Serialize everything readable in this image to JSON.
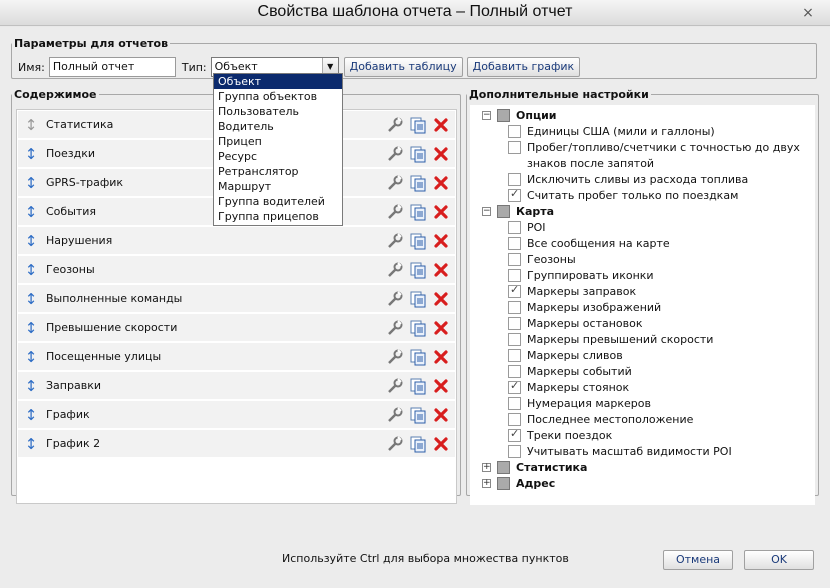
{
  "window": {
    "title": "Свойства шаблона отчета – Полный отчет",
    "close_glyph": "×"
  },
  "params": {
    "legend": "Параметры для отчетов",
    "name_label": "Имя:",
    "name_value": "Полный отчет",
    "type_label": "Тип:",
    "type_value": "Объект",
    "add_table": "Добавить таблицу",
    "add_chart": "Добавить график"
  },
  "type_dropdown": {
    "options": [
      "Объект",
      "Группа объектов",
      "Пользователь",
      "Водитель",
      "Прицеп",
      "Ресурс",
      "Ретранслятор",
      "Маршрут",
      "Группа водителей",
      "Группа прицепов"
    ],
    "selected_index": 0
  },
  "content": {
    "legend": "Содержимое",
    "rows": [
      "Статистика",
      "Поездки",
      "GPRS-трафик",
      "События",
      "Нарушения",
      "Геозоны",
      "Выполненные команды",
      "Превышение скорости",
      "Посещенные улицы",
      "Заправки",
      "График",
      "График 2"
    ],
    "icons": [
      "drag-arrows-icon",
      "wrench-icon",
      "copy-icon",
      "delete-x-icon"
    ]
  },
  "extra": {
    "legend": "Дополнительные настройки",
    "options_group": "Опции",
    "options": [
      {
        "label": "Единицы США (мили и галлоны)",
        "checked": false
      },
      {
        "label": "Пробег/топливо/счетчики с точностью до двух",
        "checked": false
      },
      {
        "label": "знаков после запятой",
        "checked": null
      },
      {
        "label": "Исключить сливы из расхода топлива",
        "checked": false
      },
      {
        "label": "Считать пробег только по поездкам",
        "checked": true
      }
    ],
    "map_group": "Карта",
    "map": [
      {
        "label": "POI",
        "checked": false
      },
      {
        "label": "Все сообщения на карте",
        "checked": false
      },
      {
        "label": "Геозоны",
        "checked": false
      },
      {
        "label": "Группировать иконки",
        "checked": false
      },
      {
        "label": "Маркеры заправок",
        "checked": true
      },
      {
        "label": "Маркеры изображений",
        "checked": false
      },
      {
        "label": "Маркеры остановок",
        "checked": false
      },
      {
        "label": "Маркеры превышений скорости",
        "checked": false
      },
      {
        "label": "Маркеры сливов",
        "checked": false
      },
      {
        "label": "Маркеры событий",
        "checked": false
      },
      {
        "label": "Маркеры стоянок",
        "checked": true
      },
      {
        "label": "Нумерация маркеров",
        "checked": false
      },
      {
        "label": "Последнее местоположение",
        "checked": false
      },
      {
        "label": "Треки поездок",
        "checked": true
      },
      {
        "label": "Учитывать масштаб видимости POI",
        "checked": false
      }
    ],
    "stats_group": "Статистика",
    "address_group": "Адрес",
    "expand_minus": "−",
    "expand_plus": "+",
    "check_glyph": "✓"
  },
  "footer": {
    "hint": "Используйте Ctrl для выбора множества пунктов",
    "cancel": "Отмена",
    "ok": "OK"
  }
}
